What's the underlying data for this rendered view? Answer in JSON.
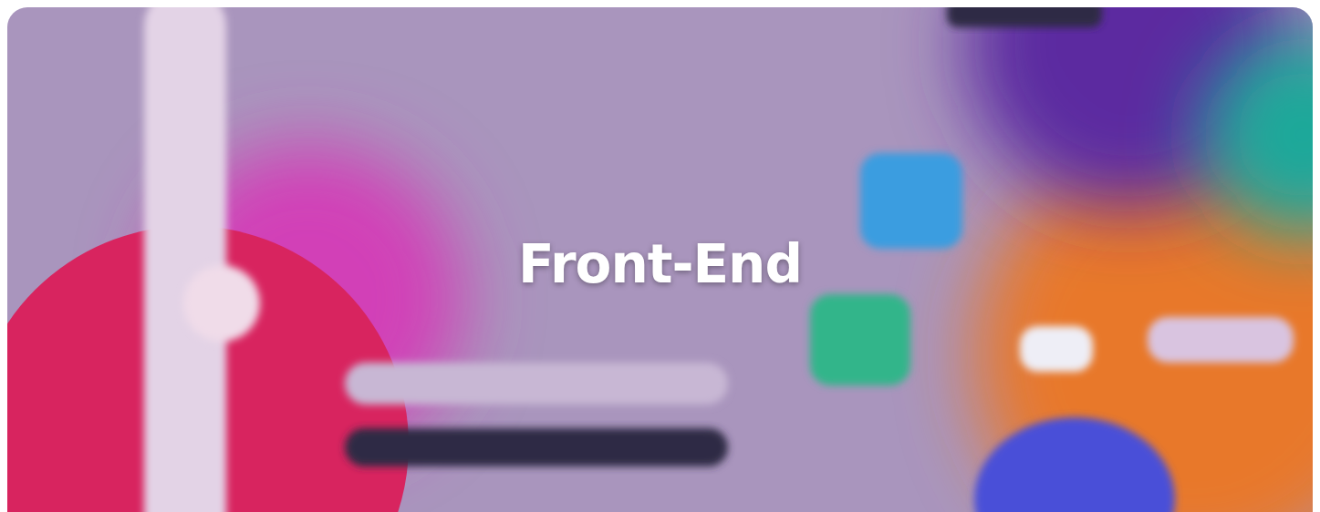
{
  "card": {
    "title": "Front-End"
  }
}
